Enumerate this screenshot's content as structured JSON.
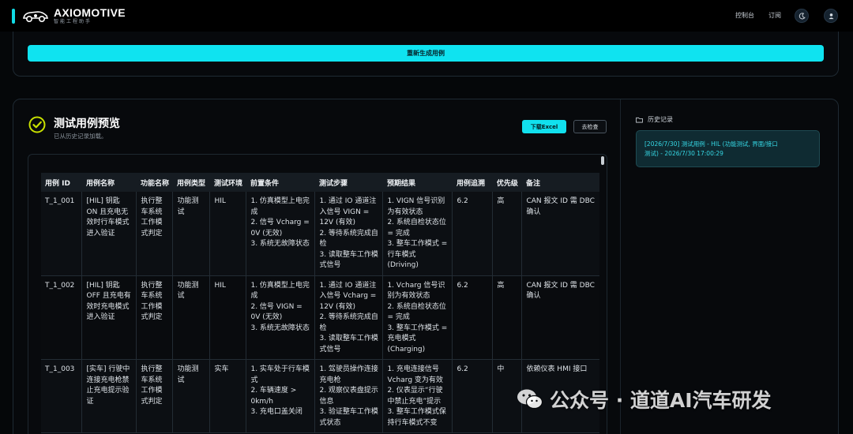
{
  "brand": {
    "name": "AXIOMOTIVE",
    "subtitle": "智能工程助手"
  },
  "nav": {
    "console": "控制台",
    "subscribe": "订阅"
  },
  "icons": {
    "theme": "moon-icon",
    "user": "user-icon",
    "history": "folder-icon",
    "check": "check-circle-icon"
  },
  "colors": {
    "accent": "#11dbe6",
    "background": "#050709",
    "check": "#c8e000"
  },
  "regen_button": "重新生成用例",
  "preview": {
    "title": "测试用例预览",
    "subtitle": "已从历史记录加载。",
    "download_button": "下载Excel",
    "check_button": "去检查"
  },
  "history": {
    "title": "历史记录",
    "item_line1": "[2026/7/30] 测试用例 - HIL (功能测试, 界面/接口",
    "item_line2": "测试) - 2026/7/30 17:00:29"
  },
  "table": {
    "headers": [
      "用例 ID",
      "用例名称",
      "功能名称",
      "用例类型",
      "测试环境",
      "前置条件",
      "测试步骤",
      "预期结果",
      "用例追溯",
      "优先级",
      "备注"
    ],
    "rows": [
      {
        "id": "T_1_001",
        "name": "[HIL] 钥匙 ON 且充电无效时行车模式进入验证",
        "func": "执行整车系统工作模式判定",
        "type": "功能测试",
        "env": "HIL",
        "pre": "1. 仿真模型上电完成\n2. 信号 Vcharg = 0V (无效)\n3. 系统无故障状态",
        "steps": "1. 通过 IO 通道注入信号 VIGN = 12V (有效)\n2. 等待系统完成自检\n3. 读取整车工作模式信号",
        "expect": "1. VIGN 信号识别为有效状态\n2. 系统自检状态位 = 完成\n3. 整车工作模式 = 行车模式 (Driving)",
        "trace": "6.2",
        "prio": "高",
        "note": "CAN 报文 ID 需 DBC 确认"
      },
      {
        "id": "T_1_002",
        "name": "[HIL] 钥匙 OFF 且充电有效时充电模式进入验证",
        "func": "执行整车系统工作模式判定",
        "type": "功能测试",
        "env": "HIL",
        "pre": "1. 仿真模型上电完成\n2. 信号 VIGN = 0V (无效)\n3. 系统无故障状态",
        "steps": "1. 通过 IO 通道注入信号 Vcharg = 12V (有效)\n2. 等待系统完成自检\n3. 读取整车工作模式信号",
        "expect": "1. Vcharg 信号识别为有效状态\n2. 系统自检状态位 = 完成\n3. 整车工作模式 = 充电模式 (Charging)",
        "trace": "6.2",
        "prio": "高",
        "note": "CAN 报文 ID 需 DBC 确认"
      },
      {
        "id": "T_1_003",
        "name": "[实车] 行驶中连接充电枪禁止充电提示验证",
        "func": "执行整车系统工作模式判定",
        "type": "功能测试",
        "env": "实车",
        "pre": "1. 实车处于行车模式\n2. 车辆速度 > 0km/h\n3. 充电口盖关闭",
        "steps": "1. 驾驶员操作连接充电枪\n2. 观察仪表盘提示信息\n3. 验证整车工作模式状态",
        "expect": "1. 充电连接信号 Vcharg 变为有效\n2. 仪表显示“行驶中禁止充电”提示\n3. 整车工作模式保持行车模式不变",
        "trace": "6.2",
        "prio": "中",
        "note": "依赖仪表 HMI 接口"
      }
    ]
  },
  "watermark": "公众号 · 道道AI汽车研发"
}
